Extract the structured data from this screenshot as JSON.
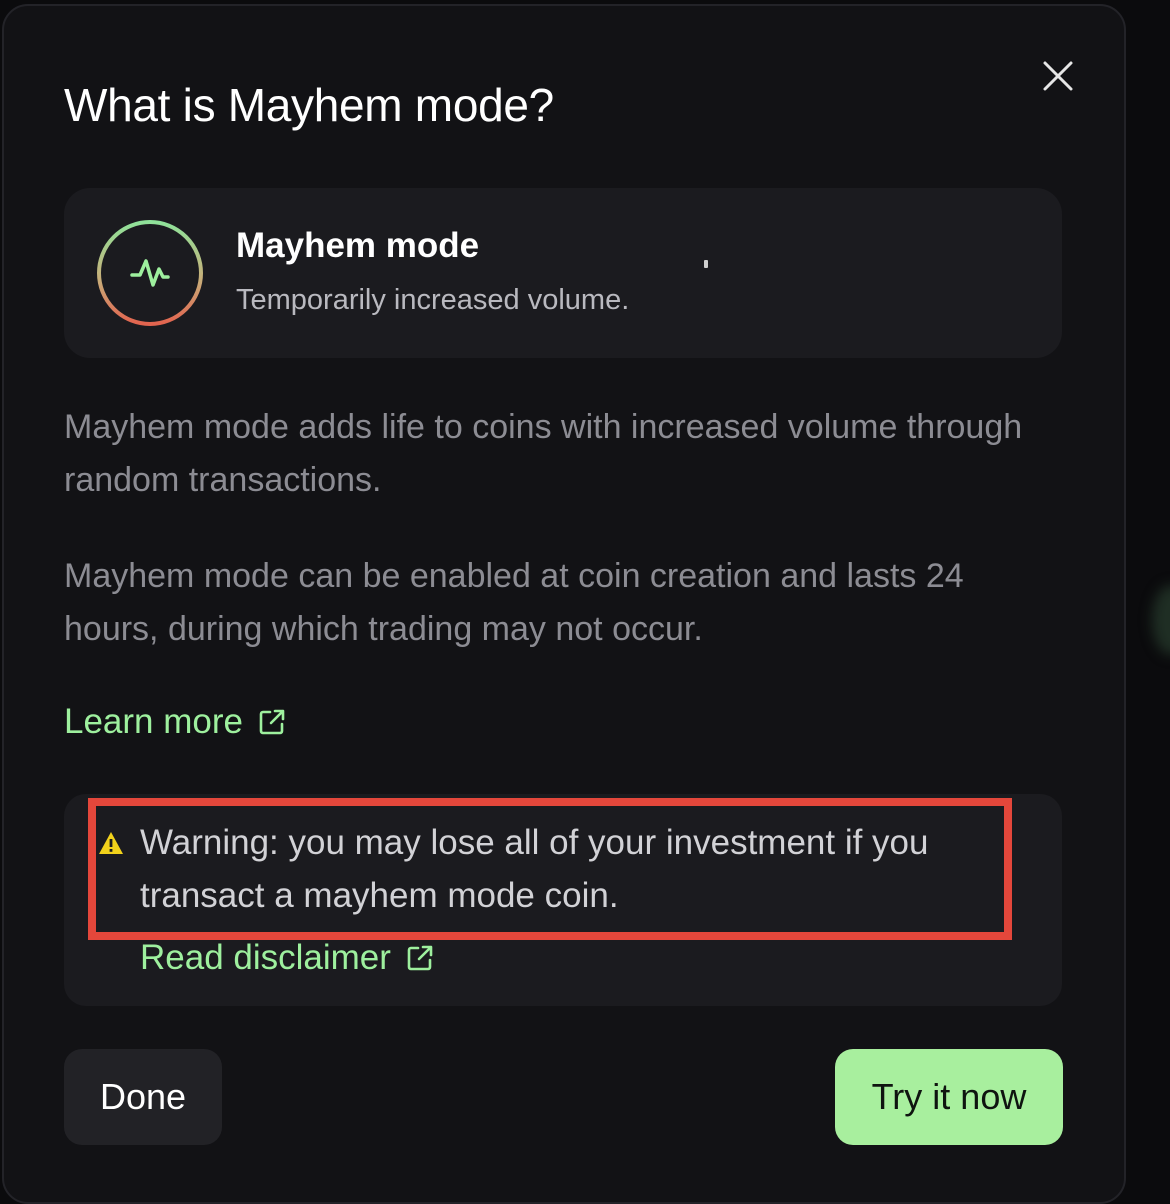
{
  "dialog": {
    "title": "What is Mayhem mode?",
    "close_icon": "close-icon"
  },
  "mode_card": {
    "icon": "activity-pulse-icon",
    "name": "Mayhem mode",
    "subtitle": "Temporarily increased volume."
  },
  "body": {
    "paragraph_1": "Mayhem mode adds life to coins with increased volume through random transactions.",
    "paragraph_2": "Mayhem mode can be enabled at coin creation and lasts 24 hours, during which trading may not occur."
  },
  "learn_more": {
    "label": "Learn more",
    "icon": "external-link-icon"
  },
  "warning": {
    "icon": "warning-triangle-icon",
    "text": "Warning: you may lose all of your investment if you transact a mayhem mode coin.",
    "disclaimer_label": "Read disclaimer",
    "disclaimer_icon": "external-link-icon"
  },
  "buttons": {
    "done_label": "Done",
    "try_label": "Try it now"
  },
  "colors": {
    "background": "#121215",
    "card": "#1b1b1f",
    "accent_green": "#9ef09e",
    "button_green": "#a8ef9e",
    "highlight_red": "#e4473b",
    "warning_yellow": "#f2d21b"
  }
}
